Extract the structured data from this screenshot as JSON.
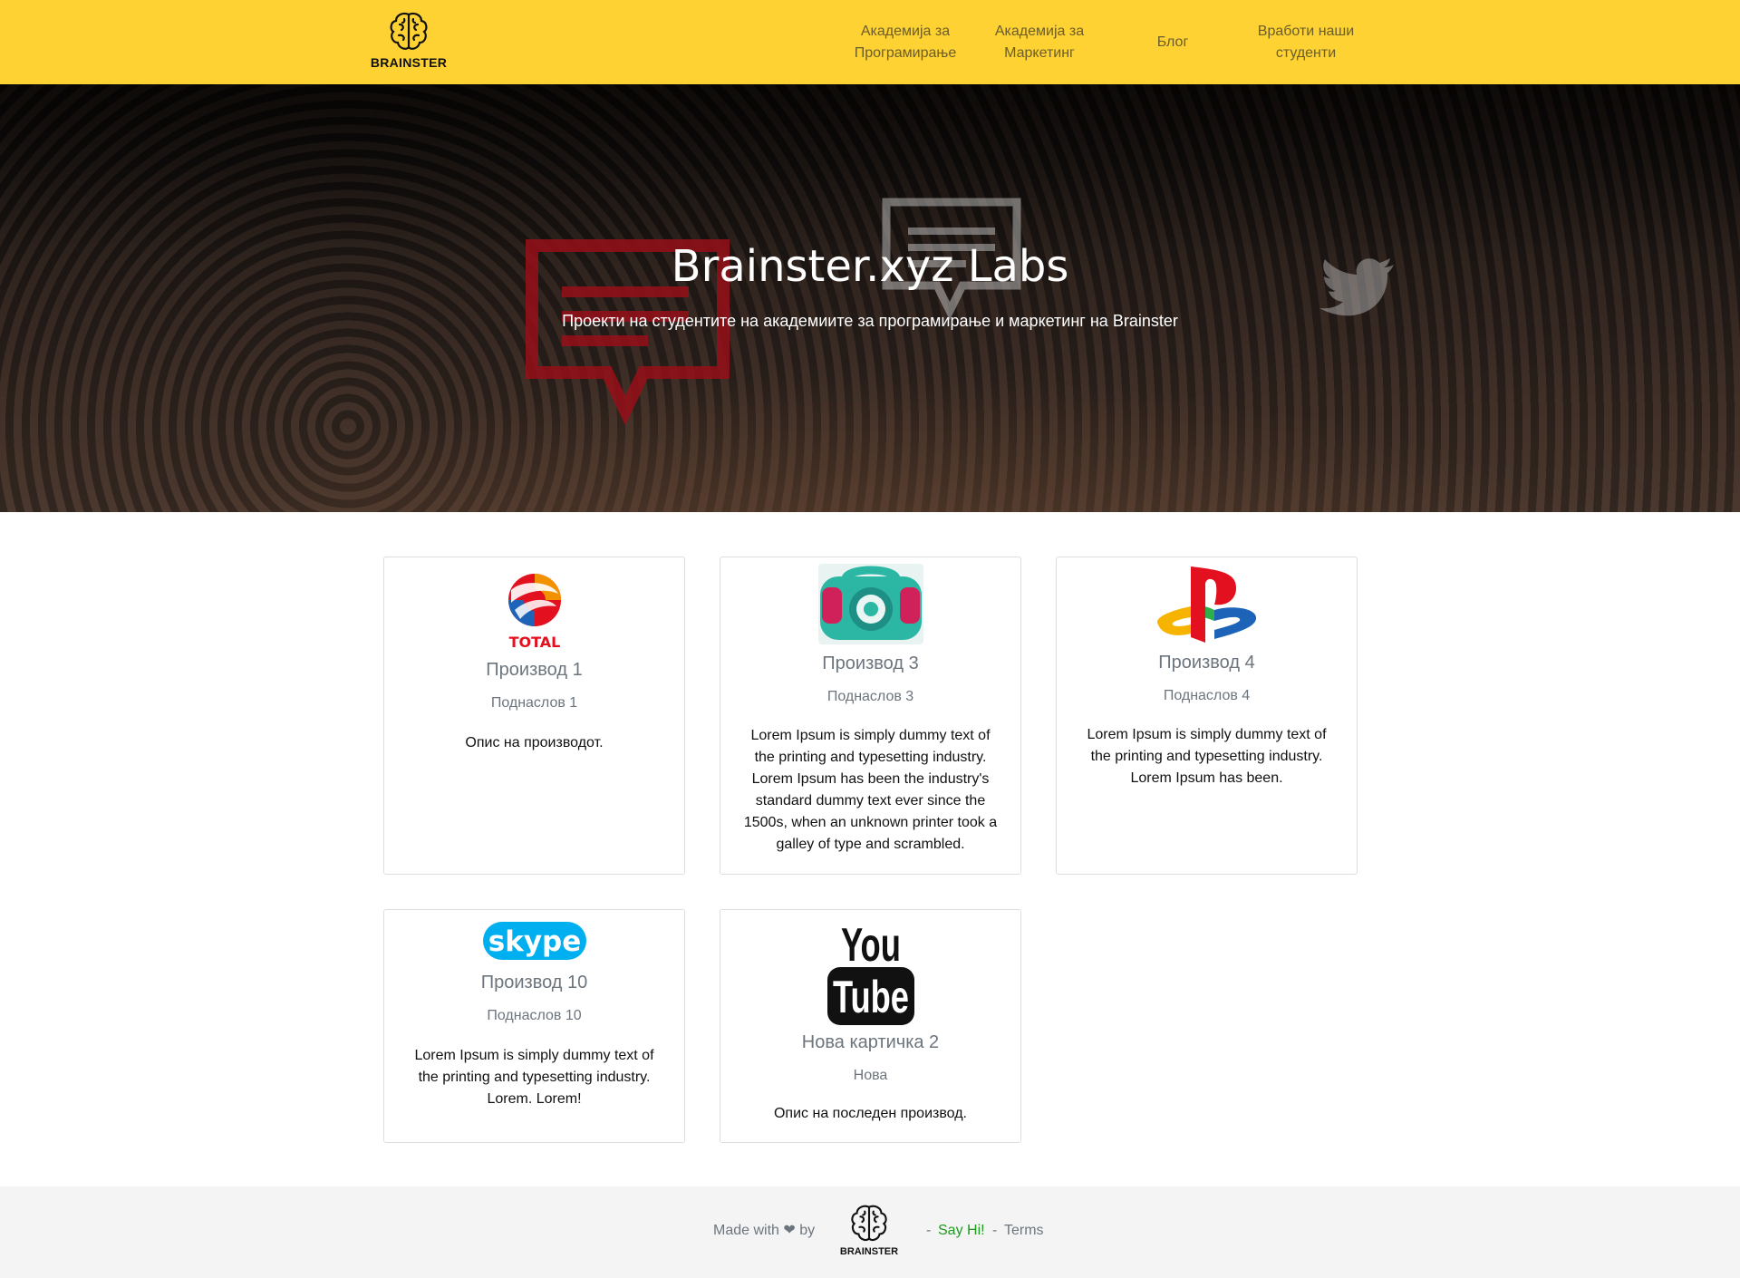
{
  "brand": {
    "name": "BRAINSTER",
    "icon": "brain-icon"
  },
  "nav": {
    "items": [
      {
        "label": "Академија за Програмирање"
      },
      {
        "label": "Академија за Маркетинг"
      },
      {
        "label": "Блог"
      },
      {
        "label": "Вработи наши студенти"
      }
    ]
  },
  "hero": {
    "title": "Brainster.xyz Labs",
    "subtitle": "Проекти на студентите на академиите за програмирање и маркетинг на Brainster"
  },
  "cards": [
    {
      "logo": "total-logo",
      "title": "Производ 1",
      "subtitle": "Поднаслов 1",
      "text": "Опис на производот."
    },
    {
      "logo": "camera-app-logo",
      "title": "Производ 3",
      "subtitle": "Поднаслов 3",
      "text": "Lorem Ipsum is simply dummy text of the printing and typesetting industry. Lorem Ipsum has been the industry's standard dummy text ever since the 1500s, when an unknown printer took a galley of type and scrambled."
    },
    {
      "logo": "playstation-logo",
      "title": "Производ 4",
      "subtitle": "Поднаслов 4",
      "text": "Lorem Ipsum is simply dummy text of the printing and typesetting industry. Lorem Ipsum has been."
    },
    {
      "logo": "skype-logo",
      "title": "Производ 10",
      "subtitle": "Поднаслов 10",
      "text": "Lorem Ipsum is simply dummy text of the printing and typesetting industry. Lorem. Lorem!"
    },
    {
      "logo": "youtube-logo",
      "title": "Нова картичка 2",
      "subtitle": "Нова",
      "text": "Опис на последен производ."
    }
  ],
  "logo_text": {
    "total": "TOTAL",
    "skype": "skype",
    "youtube_top": "You",
    "youtube_bottom": "Tube"
  },
  "footer": {
    "made_with": "Made with ❤ by",
    "brand": "BRAINSTER",
    "sep1": "-",
    "say_hi": "Say Hi!",
    "sep2": "-",
    "terms": "Terms"
  },
  "colors": {
    "navbar": "#fdd232",
    "footer": "#f4f4f4",
    "link_green": "#1e9a1e"
  }
}
